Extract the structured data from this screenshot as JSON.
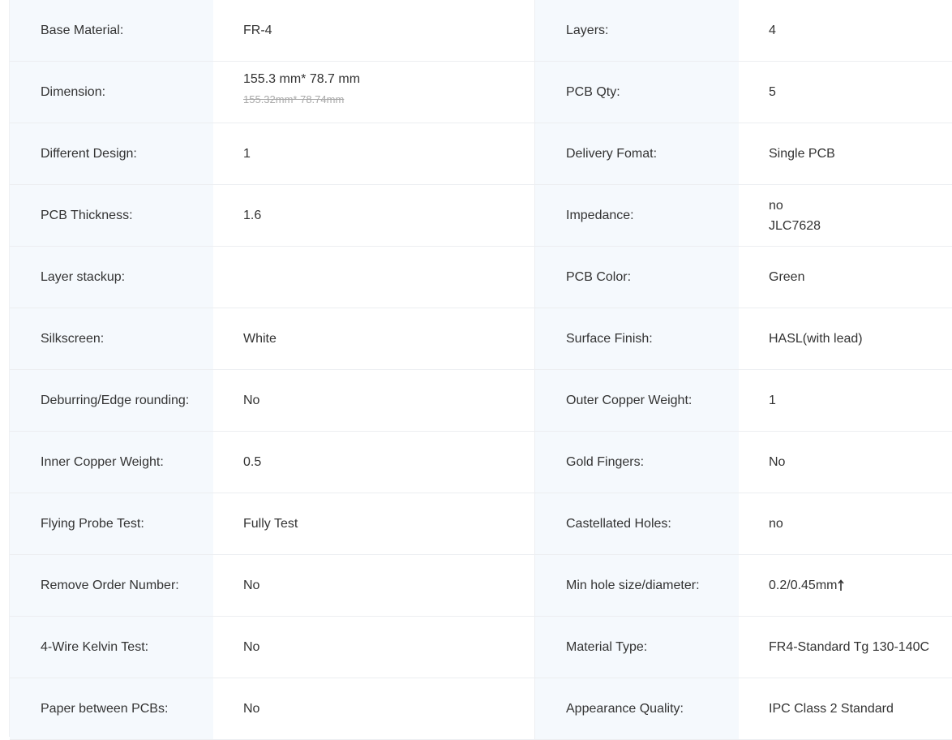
{
  "specs": {
    "base_material": {
      "label": "Base Material:",
      "value": "FR-4"
    },
    "layers": {
      "label": "Layers:",
      "value": "4"
    },
    "dimension": {
      "label": "Dimension:",
      "value": "155.3 mm* 78.7 mm",
      "original_value": "155.32mm* 78.74mm"
    },
    "pcb_qty": {
      "label": "PCB Qty:",
      "value": "5"
    },
    "different_design": {
      "label": "Different Design:",
      "value": "1"
    },
    "delivery_format": {
      "label": "Delivery Fomat:",
      "value": "Single PCB"
    },
    "pcb_thickness": {
      "label": "PCB Thickness:",
      "value": "1.6"
    },
    "impedance": {
      "label": "Impedance:",
      "value": "no",
      "stackup_code": "JLC7628"
    },
    "layer_stackup": {
      "label": "Layer stackup:",
      "value": ""
    },
    "pcb_color": {
      "label": "PCB Color:",
      "value": "Green"
    },
    "silkscreen": {
      "label": "Silkscreen:",
      "value": "White"
    },
    "surface_finish": {
      "label": "Surface Finish:",
      "value": "HASL(with lead)"
    },
    "deburring": {
      "label": "Deburring/Edge rounding:",
      "value": "No"
    },
    "outer_copper_weight": {
      "label": "Outer Copper Weight:",
      "value": "1"
    },
    "inner_copper_weight": {
      "label": "Inner Copper Weight:",
      "value": "0.5"
    },
    "gold_fingers": {
      "label": "Gold Fingers:",
      "value": "No"
    },
    "flying_probe_test": {
      "label": "Flying Probe Test:",
      "value": "Fully Test"
    },
    "castellated_holes": {
      "label": "Castellated Holes:",
      "value": "no"
    },
    "remove_order_number": {
      "label": "Remove Order Number:",
      "value": "No"
    },
    "min_hole_size": {
      "label": "Min hole size/diameter:",
      "value": "0.2/0.45mm",
      "icon": "arrow-up-icon"
    },
    "four_wire_kelvin": {
      "label": "4-Wire Kelvin Test:",
      "value": "No"
    },
    "material_type": {
      "label": "Material Type:",
      "value": "FR4-Standard Tg 130-140C"
    },
    "paper_between_pcbs": {
      "label": "Paper between PCBs:",
      "value": "No"
    },
    "appearance_quality": {
      "label": "Appearance Quality:",
      "value": "IPC Class 2 Standard"
    }
  },
  "colors": {
    "label_bg": "#f5f9fd",
    "value_bg": "#ffffff",
    "text": "#333333",
    "strike_text": "#a9a9a9",
    "border": "#eceef1"
  }
}
